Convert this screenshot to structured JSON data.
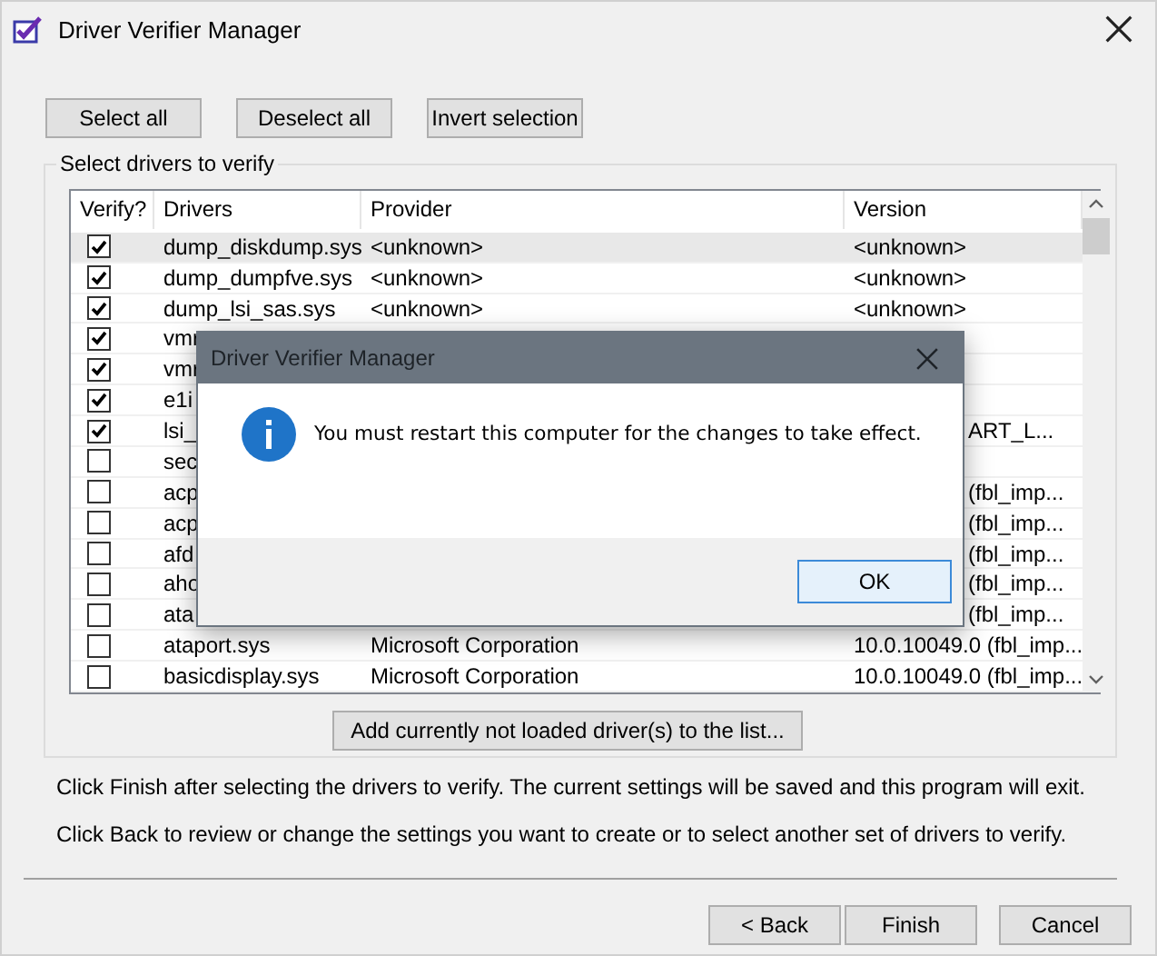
{
  "window": {
    "title": "Driver Verifier Manager"
  },
  "toolbar_buttons": [
    "Select all",
    "Deselect all",
    "Invert selection"
  ],
  "group": {
    "title": "Select drivers to verify"
  },
  "table": {
    "columns": [
      "Verify?",
      "Drivers",
      "Provider",
      "Version"
    ],
    "rows": [
      {
        "kind": "full",
        "checked": true,
        "selected": true,
        "driver": "dump_diskdump.sys",
        "provider": "<unknown>",
        "version": "<unknown>"
      },
      {
        "kind": "full",
        "checked": true,
        "selected": false,
        "driver": "dump_dumpfve.sys",
        "provider": "<unknown>",
        "version": "<unknown>"
      },
      {
        "kind": "full",
        "checked": true,
        "selected": false,
        "driver": "dump_lsi_sas.sys",
        "provider": "<unknown>",
        "version": "<unknown>"
      },
      {
        "kind": "covered",
        "checked": true,
        "driver": "vmr"
      },
      {
        "kind": "covered",
        "checked": true,
        "driver": "vmr"
      },
      {
        "kind": "covered",
        "checked": true,
        "driver": "e1i"
      },
      {
        "kind": "covered",
        "checked": true,
        "driver": "lsi_",
        "version": "ART_L..."
      },
      {
        "kind": "covered",
        "checked": false,
        "driver": "sec"
      },
      {
        "kind": "covered",
        "checked": false,
        "driver": "acp",
        "version": "(fbl_imp..."
      },
      {
        "kind": "covered",
        "checked": false,
        "driver": "acp",
        "version": "(fbl_imp..."
      },
      {
        "kind": "covered",
        "checked": false,
        "driver": "afd",
        "version": "(fbl_imp..."
      },
      {
        "kind": "covered",
        "checked": false,
        "driver": "aho",
        "version": "(fbl_imp..."
      },
      {
        "kind": "covered",
        "checked": false,
        "driver": "ata",
        "version": "(fbl_imp..."
      },
      {
        "kind": "full",
        "checked": false,
        "selected": false,
        "driver": "ataport.sys",
        "provider": "Microsoft Corporation",
        "version": "10.0.10049.0 (fbl_imp..."
      },
      {
        "kind": "full",
        "checked": false,
        "selected": false,
        "driver": "basicdisplay.sys",
        "provider": "Microsoft Corporation",
        "version": "10.0.10049.0 (fbl_imp..."
      }
    ]
  },
  "add_button": "Add currently not loaded driver(s) to the list...",
  "instructions": [
    "Click Finish after selecting the drivers to verify. The current settings will be saved and this program will exit.",
    "Click Back to review or change the settings you want to create or to select another set of drivers to verify."
  ],
  "footer_buttons": [
    "< Back",
    "Finish",
    "Cancel"
  ],
  "dialog": {
    "title": "Driver Verifier Manager",
    "message": "You must restart this computer for the changes to take effect.",
    "button": "OK"
  }
}
